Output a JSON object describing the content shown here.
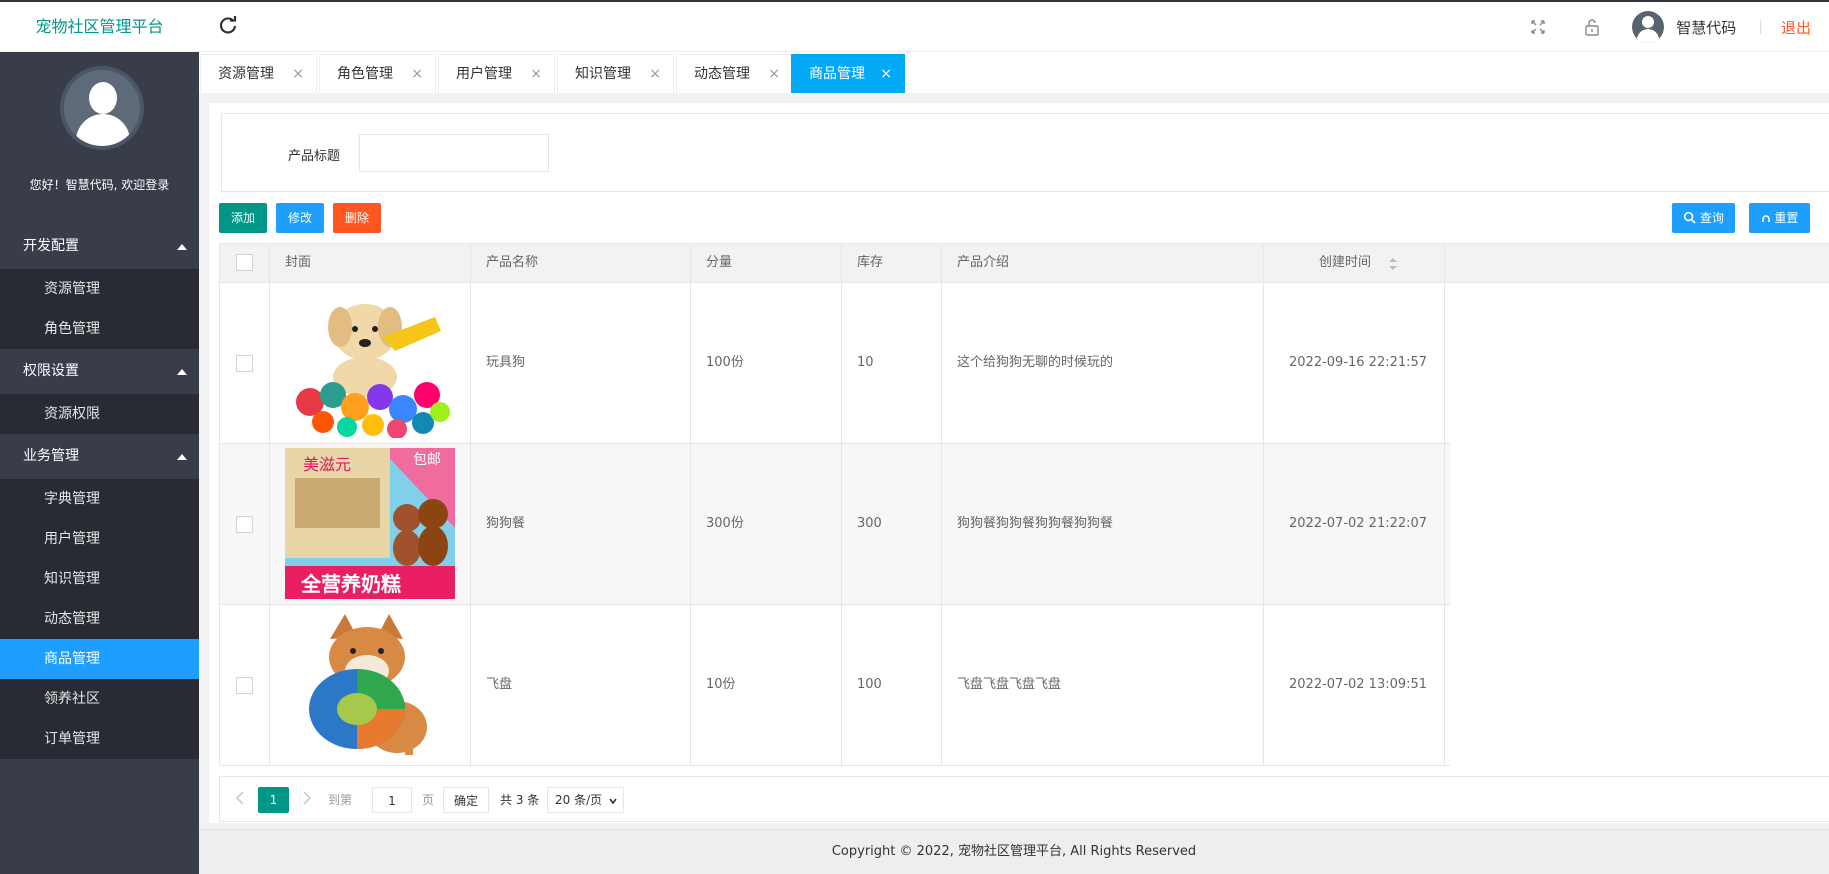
{
  "header": {
    "brand": "宠物社区管理平台",
    "user_name": "智慧代码",
    "separator": "|",
    "logout": "退出"
  },
  "sidebar": {
    "welcome": "您好！智慧代码, 欢迎登录",
    "groups": [
      {
        "label": "开发配置",
        "items": [
          "资源管理",
          "角色管理"
        ]
      },
      {
        "label": "权限设置",
        "items": [
          "资源权限"
        ]
      },
      {
        "label": "业务管理",
        "items": [
          "字典管理",
          "用户管理",
          "知识管理",
          "动态管理",
          "商品管理",
          "领养社区",
          "订单管理"
        ]
      }
    ],
    "active_item": "商品管理"
  },
  "tabs": [
    {
      "label": "资源管理",
      "close": "×"
    },
    {
      "label": "角色管理",
      "close": "×"
    },
    {
      "label": "用户管理",
      "close": "×"
    },
    {
      "label": "知识管理",
      "close": "×"
    },
    {
      "label": "动态管理",
      "close": "×"
    },
    {
      "label": "商品管理",
      "close": "×",
      "active": true
    }
  ],
  "search": {
    "label": "产品标题",
    "value": ""
  },
  "toolbar": {
    "add": "添加",
    "edit": "修改",
    "delete": "删除",
    "query": "查询",
    "reset": "重置"
  },
  "table": {
    "columns": [
      "封面",
      "产品名称",
      "分量",
      "库存",
      "产品介绍",
      "创建时间"
    ],
    "rows": [
      {
        "name": "玩具狗",
        "amount": "100份",
        "stock": "10",
        "intro": "这个给狗狗无聊的时候玩的",
        "created": "2022-09-16 22:21:57"
      },
      {
        "name": "狗狗餐",
        "amount": "300份",
        "stock": "300",
        "intro": "狗狗餐狗狗餐狗狗餐狗狗餐",
        "created": "2022-07-02 21:22:07"
      },
      {
        "name": "飞盘",
        "amount": "10份",
        "stock": "100",
        "intro": "飞盘飞盘飞盘飞盘",
        "created": "2022-07-02 13:09:51"
      }
    ],
    "cover_texts": {
      "bag_brand": "美滋元",
      "bag_badge": "包邮",
      "bag_slogan": "全营养奶糕"
    }
  },
  "pagination": {
    "current": "1",
    "goto_label": "到第",
    "goto_value": "1",
    "page_unit": "页",
    "confirm": "确定",
    "total": "共 3 条",
    "page_size": "20 条/页"
  },
  "footer": {
    "copyright": "Copyright © 2022, 宠物社区管理平台, All Rights Reserved"
  },
  "colors": {
    "brand": "#009688",
    "active_blue": "#1e9fff",
    "tab_active": "#03a9f4",
    "danger": "#ff5722",
    "sidebar_bg": "#393d49"
  }
}
